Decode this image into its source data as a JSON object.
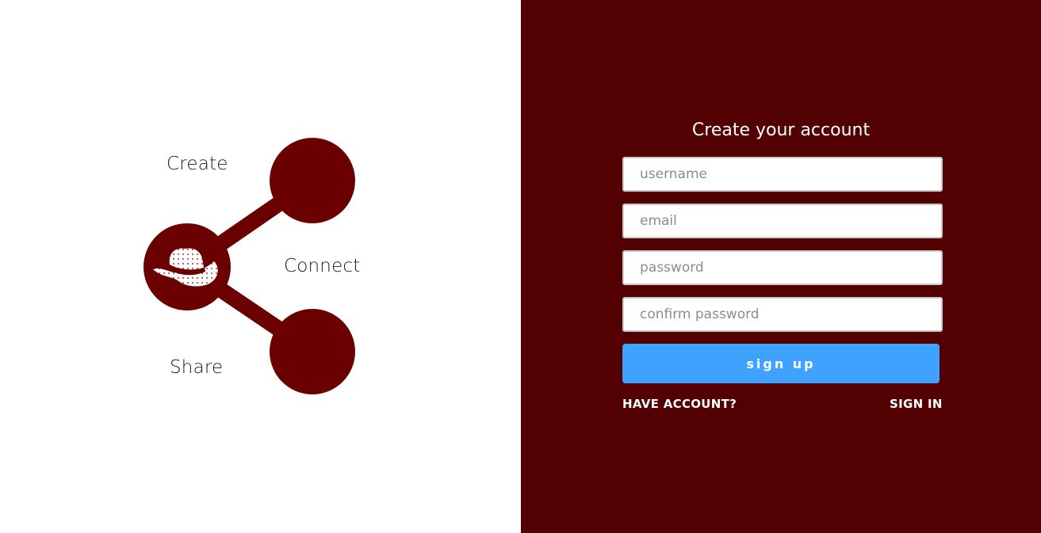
{
  "brand": {
    "words": [
      "Create",
      "Connect",
      "Share"
    ],
    "logo_icon": "cowboy-hat-icon",
    "color": "#6b0000"
  },
  "signup_form": {
    "title": "Create your account",
    "fields": [
      {
        "name": "username",
        "placeholder": "username"
      },
      {
        "name": "email",
        "placeholder": "email"
      },
      {
        "name": "password",
        "placeholder": "password"
      },
      {
        "name": "confirm-password",
        "placeholder": "confirm password"
      }
    ],
    "submit_label": "sign up",
    "have_account_label": "HAVE ACCOUNT?",
    "sign_in_label": "SIGN IN"
  },
  "colors": {
    "panel_background": "#520002",
    "button": "#3fa2fe"
  }
}
